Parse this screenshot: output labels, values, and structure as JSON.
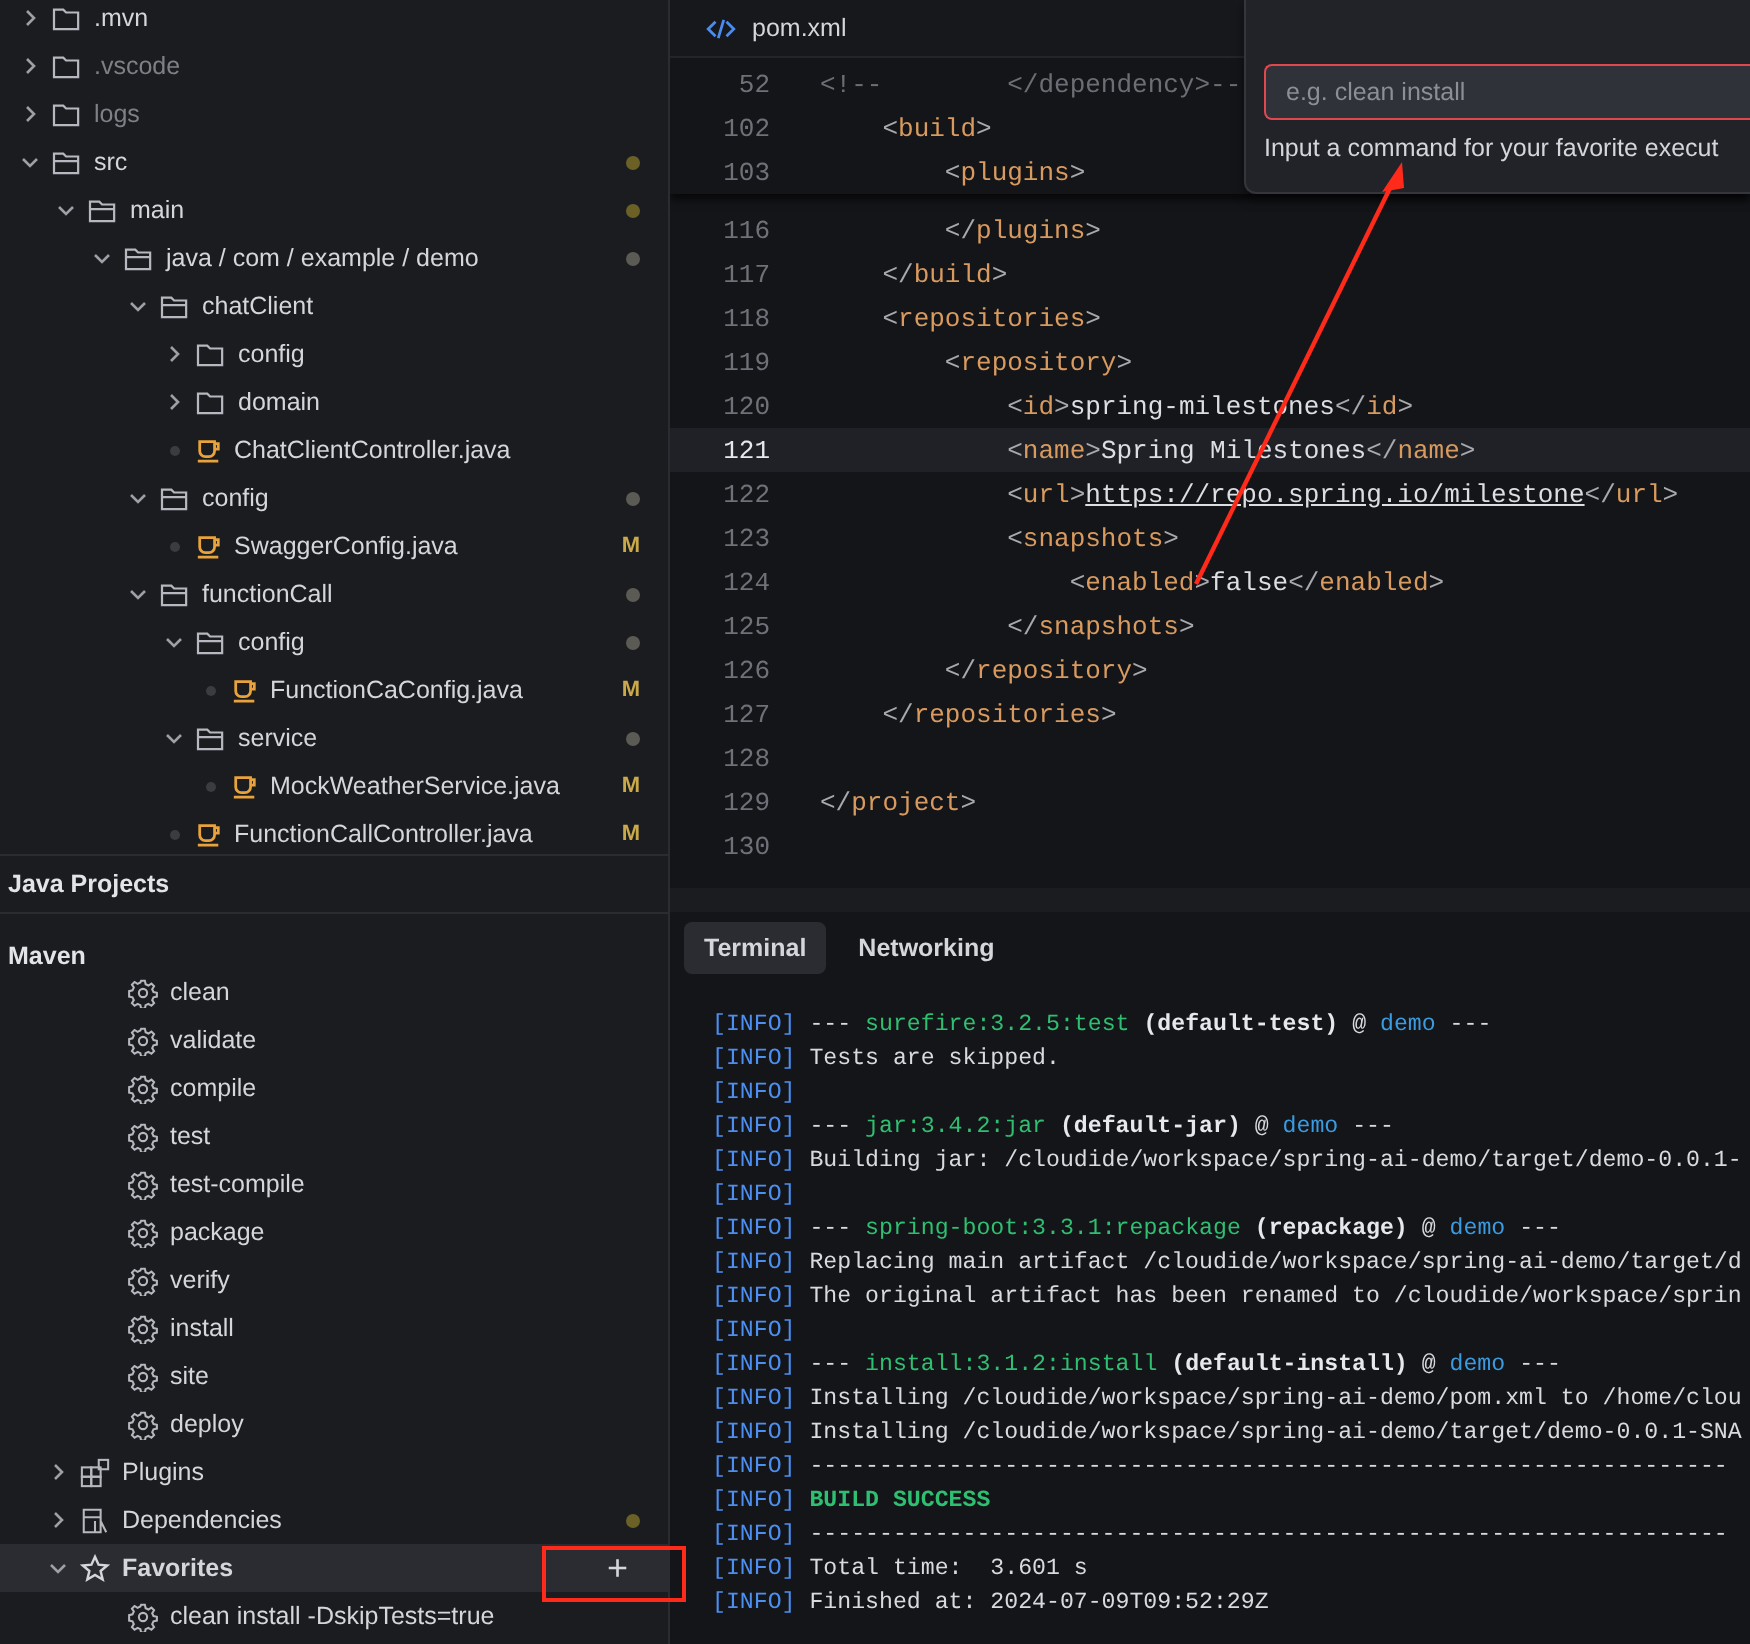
{
  "explorer": {
    "nodes": [
      {
        "name": ".mvn",
        "kind": "folder",
        "expanded": false,
        "dimmed": false
      },
      {
        "name": ".vscode",
        "kind": "folder",
        "expanded": false,
        "dimmed": true
      },
      {
        "name": "logs",
        "kind": "folder",
        "expanded": false,
        "dimmed": true
      },
      {
        "name": "src",
        "kind": "folder",
        "expanded": true,
        "dimmed": false,
        "color": "#6b6126",
        "children": [
          {
            "name": "main",
            "kind": "folder",
            "expanded": true,
            "dimmed": false,
            "color": "#6b6126",
            "children": [
              {
                "name": "java / com / example / demo",
                "kind": "folder",
                "expanded": true,
                "dimmed": false,
                "color": "#5c5a55",
                "children": [
                  {
                    "name": "chatClient",
                    "kind": "folder",
                    "expanded": true,
                    "dimmed": false,
                    "children": [
                      {
                        "name": "config",
                        "kind": "folder",
                        "expanded": false,
                        "dimmed": false
                      },
                      {
                        "name": "domain",
                        "kind": "folder",
                        "expanded": false,
                        "dimmed": false
                      },
                      {
                        "name": "ChatClientController.java",
                        "kind": "java",
                        "dimmed": false
                      }
                    ]
                  },
                  {
                    "name": "config",
                    "kind": "folder",
                    "expanded": true,
                    "dimmed": false,
                    "color": "#5c5a55",
                    "children": [
                      {
                        "name": "SwaggerConfig.java",
                        "kind": "java",
                        "dimmed": false,
                        "badge": "M"
                      }
                    ]
                  },
                  {
                    "name": "functionCall",
                    "kind": "folder",
                    "expanded": true,
                    "dimmed": false,
                    "color": "#5c5a55",
                    "children": [
                      {
                        "name": "config",
                        "kind": "folder",
                        "expanded": true,
                        "dimmed": false,
                        "color": "#5c5a55",
                        "children": [
                          {
                            "name": "FunctionCaConfig.java",
                            "kind": "java",
                            "dimmed": false,
                            "badge": "M"
                          }
                        ]
                      },
                      {
                        "name": "service",
                        "kind": "folder",
                        "expanded": true,
                        "dimmed": false,
                        "color": "#5c5a55",
                        "children": [
                          {
                            "name": "MockWeatherService.java",
                            "kind": "java",
                            "dimmed": false,
                            "badge": "M"
                          }
                        ]
                      },
                      {
                        "name": "FunctionCallController.java",
                        "kind": "java",
                        "dimmed": false,
                        "badge": "M"
                      }
                    ]
                  }
                ]
              }
            ]
          }
        ]
      }
    ]
  },
  "java_projects": {
    "title": "Java Projects"
  },
  "maven": {
    "title": "Maven",
    "goals": [
      "clean",
      "validate",
      "compile",
      "test",
      "test-compile",
      "package",
      "verify",
      "install",
      "site",
      "deploy"
    ],
    "groups": [
      {
        "label": "Plugins",
        "kind": "plugins",
        "expanded": false,
        "selected": false
      },
      {
        "label": "Dependencies",
        "kind": "dependencies",
        "expanded": false,
        "selected": false,
        "color": "#6b6126"
      },
      {
        "label": "Favorites",
        "kind": "favorites",
        "expanded": true,
        "selected": true,
        "action": "+",
        "children": [
          "clean install -DskipTests=true"
        ]
      }
    ]
  },
  "editor": {
    "tab": "pom.xml",
    "sticky_lines": [
      {
        "number": "52",
        "current": false,
        "tokens": [
          {
            "kind": "comment",
            "text": "<!--        </dependency>--"
          }
        ]
      },
      {
        "number": "102",
        "current": false,
        "tokens": [
          {
            "kind": "punct",
            "text": "    <"
          },
          {
            "kind": "tag",
            "text": "build"
          },
          {
            "kind": "punct",
            "text": ">"
          }
        ]
      },
      {
        "number": "103",
        "current": false,
        "tokens": [
          {
            "kind": "punct",
            "text": "        <"
          },
          {
            "kind": "tag",
            "text": "plugins"
          },
          {
            "kind": "punct",
            "text": ">"
          }
        ]
      }
    ],
    "lines": [
      {
        "number": "116",
        "current": false,
        "tokens": [
          {
            "kind": "punct",
            "text": "        </"
          },
          {
            "kind": "tag",
            "text": "plugins"
          },
          {
            "kind": "punct",
            "text": ">"
          }
        ]
      },
      {
        "number": "117",
        "current": false,
        "tokens": [
          {
            "kind": "punct",
            "text": "    </"
          },
          {
            "kind": "tag",
            "text": "build"
          },
          {
            "kind": "punct",
            "text": ">"
          }
        ]
      },
      {
        "number": "118",
        "current": false,
        "tokens": [
          {
            "kind": "punct",
            "text": "    <"
          },
          {
            "kind": "tag",
            "text": "repositories"
          },
          {
            "kind": "punct",
            "text": ">"
          }
        ]
      },
      {
        "number": "119",
        "current": false,
        "tokens": [
          {
            "kind": "punct",
            "text": "        <"
          },
          {
            "kind": "tag",
            "text": "repository"
          },
          {
            "kind": "punct",
            "text": ">"
          }
        ]
      },
      {
        "number": "120",
        "current": false,
        "tokens": [
          {
            "kind": "punct",
            "text": "            <"
          },
          {
            "kind": "tag",
            "text": "id"
          },
          {
            "kind": "punct",
            "text": ">"
          },
          {
            "kind": "value",
            "text": "spring-milestones"
          },
          {
            "kind": "punct",
            "text": "</"
          },
          {
            "kind": "tag",
            "text": "id"
          },
          {
            "kind": "punct",
            "text": ">"
          }
        ]
      },
      {
        "number": "121",
        "current": true,
        "tokens": [
          {
            "kind": "punct",
            "text": "            <"
          },
          {
            "kind": "tag",
            "text": "name"
          },
          {
            "kind": "punct",
            "text": ">"
          },
          {
            "kind": "value",
            "text": "Spring Milestones"
          },
          {
            "kind": "punct",
            "text": "</"
          },
          {
            "kind": "tag",
            "text": "name"
          },
          {
            "kind": "punct",
            "text": ">"
          }
        ]
      },
      {
        "number": "122",
        "current": false,
        "tokens": [
          {
            "kind": "punct",
            "text": "            <"
          },
          {
            "kind": "tag",
            "text": "url"
          },
          {
            "kind": "punct",
            "text": ">"
          },
          {
            "kind": "link",
            "text": "https://repo.spring.io/milestone"
          },
          {
            "kind": "punct",
            "text": "</"
          },
          {
            "kind": "tag",
            "text": "url"
          },
          {
            "kind": "punct",
            "text": ">"
          }
        ]
      },
      {
        "number": "123",
        "current": false,
        "tokens": [
          {
            "kind": "punct",
            "text": "            <"
          },
          {
            "kind": "tag",
            "text": "snapshots"
          },
          {
            "kind": "punct",
            "text": ">"
          }
        ]
      },
      {
        "number": "124",
        "current": false,
        "tokens": [
          {
            "kind": "punct",
            "text": "                <"
          },
          {
            "kind": "tag",
            "text": "enabled"
          },
          {
            "kind": "punct",
            "text": ">"
          },
          {
            "kind": "value",
            "text": "false"
          },
          {
            "kind": "punct",
            "text": "</"
          },
          {
            "kind": "tag",
            "text": "enabled"
          },
          {
            "kind": "punct",
            "text": ">"
          }
        ]
      },
      {
        "number": "125",
        "current": false,
        "tokens": [
          {
            "kind": "punct",
            "text": "            </"
          },
          {
            "kind": "tag",
            "text": "snapshots"
          },
          {
            "kind": "punct",
            "text": ">"
          }
        ]
      },
      {
        "number": "126",
        "current": false,
        "tokens": [
          {
            "kind": "punct",
            "text": "        </"
          },
          {
            "kind": "tag",
            "text": "repository"
          },
          {
            "kind": "punct",
            "text": ">"
          }
        ]
      },
      {
        "number": "127",
        "current": false,
        "tokens": [
          {
            "kind": "punct",
            "text": "    </"
          },
          {
            "kind": "tag",
            "text": "repositories"
          },
          {
            "kind": "punct",
            "text": ">"
          }
        ]
      },
      {
        "number": "128",
        "current": false
      },
      {
        "number": "129",
        "current": false,
        "tokens": [
          {
            "kind": "punct",
            "text": "</"
          },
          {
            "kind": "tag",
            "text": "project"
          },
          {
            "kind": "punct",
            "text": ">"
          }
        ]
      },
      {
        "number": "130",
        "current": false
      }
    ]
  },
  "command_popup": {
    "placeholder": "e.g. clean install",
    "hint": "Input a command for your favorite execut"
  },
  "panel": {
    "tabs": [
      {
        "label": "Terminal",
        "selected": true
      },
      {
        "label": "Networking",
        "selected": false
      }
    ],
    "terminal": [
      [
        {
          "kind": "level",
          "text": "[INFO]"
        },
        {
          "kind": "plain",
          "text": " --- "
        },
        {
          "kind": "plugin",
          "text": "surefire:3.2.5:test"
        },
        {
          "kind": "bold",
          "text": " (default-test)"
        },
        {
          "kind": "plain",
          "text": " @ "
        },
        {
          "kind": "project",
          "text": "demo"
        },
        {
          "kind": "plain",
          "text": " ---"
        }
      ],
      [
        {
          "kind": "level",
          "text": "[INFO]"
        },
        {
          "kind": "plain",
          "text": " Tests are skipped."
        }
      ],
      [
        {
          "kind": "level",
          "text": "[INFO]"
        }
      ],
      [
        {
          "kind": "level",
          "text": "[INFO]"
        },
        {
          "kind": "plain",
          "text": " --- "
        },
        {
          "kind": "plugin",
          "text": "jar:3.4.2:jar"
        },
        {
          "kind": "bold",
          "text": " (default-jar)"
        },
        {
          "kind": "plain",
          "text": " @ "
        },
        {
          "kind": "project",
          "text": "demo"
        },
        {
          "kind": "plain",
          "text": " ---"
        }
      ],
      [
        {
          "kind": "level",
          "text": "[INFO]"
        },
        {
          "kind": "plain",
          "text": " Building jar: /cloudide/workspace/spring-ai-demo/target/demo-0.0.1-"
        }
      ],
      [
        {
          "kind": "level",
          "text": "[INFO]"
        }
      ],
      [
        {
          "kind": "level",
          "text": "[INFO]"
        },
        {
          "kind": "plain",
          "text": " --- "
        },
        {
          "kind": "plugin",
          "text": "spring-boot:3.3.1:repackage"
        },
        {
          "kind": "bold",
          "text": " (repackage)"
        },
        {
          "kind": "plain",
          "text": " @ "
        },
        {
          "kind": "project",
          "text": "demo"
        },
        {
          "kind": "plain",
          "text": " ---"
        }
      ],
      [
        {
          "kind": "level",
          "text": "[INFO]"
        },
        {
          "kind": "plain",
          "text": " Replacing main artifact /cloudide/workspace/spring-ai-demo/target/d"
        }
      ],
      [
        {
          "kind": "level",
          "text": "[INFO]"
        },
        {
          "kind": "plain",
          "text": " The original artifact has been renamed to /cloudide/workspace/sprin"
        }
      ],
      [
        {
          "kind": "level",
          "text": "[INFO]"
        }
      ],
      [
        {
          "kind": "level",
          "text": "[INFO]"
        },
        {
          "kind": "plain",
          "text": " --- "
        },
        {
          "kind": "plugin",
          "text": "install:3.1.2:install"
        },
        {
          "kind": "bold",
          "text": " (default-install)"
        },
        {
          "kind": "plain",
          "text": " @ "
        },
        {
          "kind": "project",
          "text": "demo"
        },
        {
          "kind": "plain",
          "text": " ---"
        }
      ],
      [
        {
          "kind": "level",
          "text": "[INFO]"
        },
        {
          "kind": "plain",
          "text": " Installing /cloudide/workspace/spring-ai-demo/pom.xml to /home/clou"
        }
      ],
      [
        {
          "kind": "level",
          "text": "[INFO]"
        },
        {
          "kind": "plain",
          "text": " Installing /cloudide/workspace/spring-ai-demo/target/demo-0.0.1-SNA"
        }
      ],
      [
        {
          "kind": "level",
          "text": "[INFO]"
        },
        {
          "kind": "plain",
          "text": " ------------------------------------------------------------------"
        }
      ],
      [
        {
          "kind": "level",
          "text": "[INFO]"
        },
        {
          "kind": "success",
          "text": " BUILD SUCCESS"
        }
      ],
      [
        {
          "kind": "level",
          "text": "[INFO]"
        },
        {
          "kind": "plain",
          "text": " ------------------------------------------------------------------"
        }
      ],
      [
        {
          "kind": "level",
          "text": "[INFO]"
        },
        {
          "kind": "plain",
          "text": " Total time:  3.601 s"
        }
      ],
      [
        {
          "kind": "level",
          "text": "[INFO]"
        },
        {
          "kind": "plain",
          "text": " Finished at: 2024-07-09T09:52:29Z"
        }
      ]
    ]
  }
}
